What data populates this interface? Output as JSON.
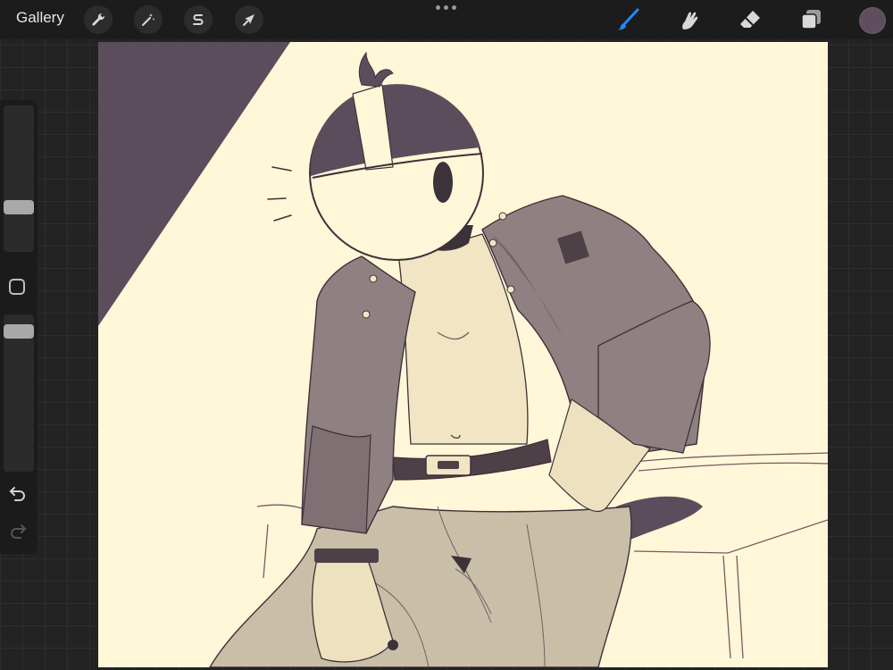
{
  "topbar": {
    "gallery_label": "Gallery",
    "left_tools": [
      {
        "icon": "wrench-icon",
        "name": "actions"
      },
      {
        "icon": "magic-wand-icon",
        "name": "adjustments"
      },
      {
        "icon": "selection-s-icon",
        "name": "selection"
      },
      {
        "icon": "arrow-cursor-icon",
        "name": "transform"
      }
    ],
    "right_tools": [
      {
        "icon": "brush-icon",
        "name": "brush",
        "active": true
      },
      {
        "icon": "smudge-icon",
        "name": "smudge"
      },
      {
        "icon": "eraser-icon",
        "name": "eraser"
      },
      {
        "icon": "layers-icon",
        "name": "layers"
      }
    ],
    "active_color": "#5f4f5e",
    "accent_color": "#1e8bff"
  },
  "sidebar": {
    "brush_size_level": 0.45,
    "opacity_level": 0.9,
    "controls": [
      "modifier-square-icon",
      "undo-icon",
      "redo-icon"
    ]
  },
  "canvas": {
    "background": "#fff7d8",
    "palette": {
      "shadow": "#5c4d5c",
      "jacket": "#8f8082",
      "jacket_dark": "#6f6264",
      "shirt": "#f2e5c4",
      "pants": "#c9bea8",
      "skin": "#eee1bf",
      "line": "#3c3239"
    }
  }
}
